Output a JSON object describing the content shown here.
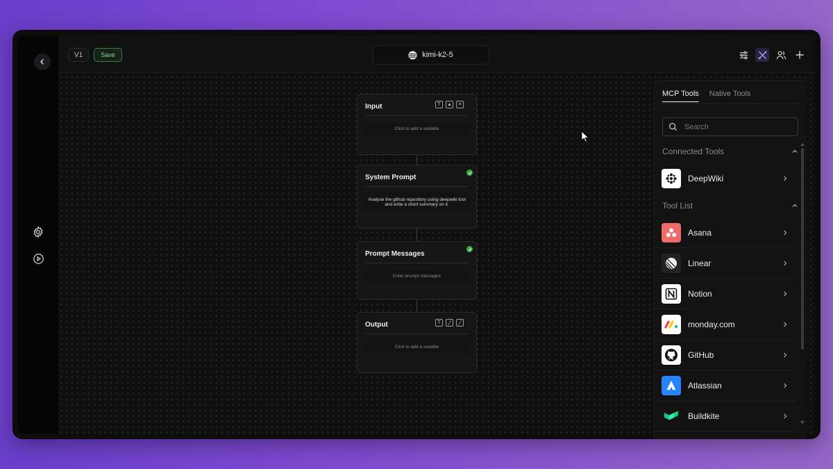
{
  "topbar": {
    "version_label": "V1",
    "save_label": "Save",
    "model_name": "kimi-k2-5",
    "icons": [
      "sliders-icon",
      "tools-icon",
      "users-icon",
      "plus-icon"
    ]
  },
  "sidebar": {
    "icons": [
      "back-arrow-icon",
      "settings-gear-icon",
      "play-circle-icon"
    ]
  },
  "nodes": {
    "input": {
      "title": "Input",
      "placeholder": "Click to add a variable"
    },
    "system_prompt": {
      "title": "System Prompt",
      "text": "Analyse the github repository using deepwiki tool and write a short summary on it."
    },
    "prompt_messages": {
      "title": "Prompt Messages",
      "placeholder": "Enter prompt messages"
    },
    "output": {
      "title": "Output",
      "placeholder": "Click to add a variable"
    }
  },
  "tools_panel": {
    "tabs": [
      {
        "label": "MCP Tools",
        "active": true
      },
      {
        "label": "Native Tools",
        "active": false
      }
    ],
    "search_placeholder": "Search",
    "connected_heading": "Connected Tools",
    "connected": [
      {
        "name": "DeepWiki",
        "icon": "deepwiki-logo",
        "color": "#ffffff"
      }
    ],
    "list_heading": "Tool List",
    "tools": [
      {
        "name": "Asana",
        "icon": "asana-logo",
        "color": "#f06a6a"
      },
      {
        "name": "Linear",
        "icon": "linear-logo",
        "color": "#222222"
      },
      {
        "name": "Notion",
        "icon": "notion-logo",
        "color": "#ffffff"
      },
      {
        "name": "monday.com",
        "icon": "monday-logo",
        "color": "#ffffff"
      },
      {
        "name": "GitHub",
        "icon": "github-logo",
        "color": "#ffffff"
      },
      {
        "name": "Atlassian",
        "icon": "atlassian-logo",
        "color": "#2684ff"
      },
      {
        "name": "Buildkite",
        "icon": "buildkite-logo",
        "color": "#14cc80"
      }
    ]
  },
  "colors": {
    "background_gradient_start": "#6a3ec9",
    "background_gradient_end": "#9466c8",
    "window": "#0c0c0d",
    "accent_green": "#3fa84a"
  }
}
